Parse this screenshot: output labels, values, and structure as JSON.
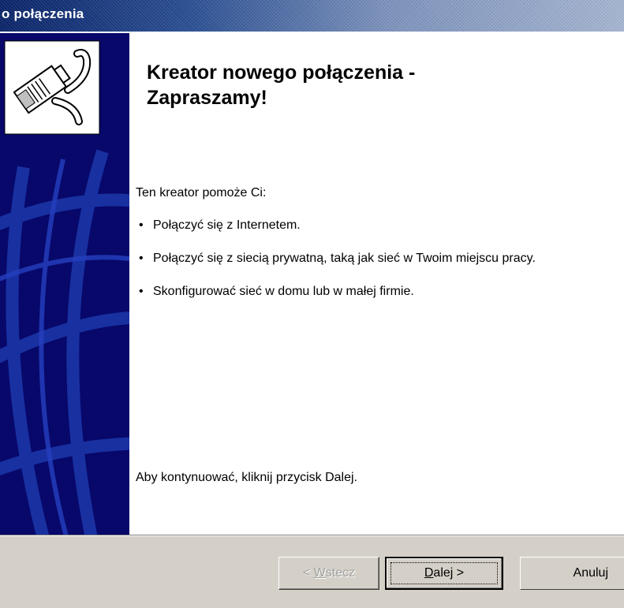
{
  "window": {
    "title": "o połączenia"
  },
  "banner": {
    "icon": "network-cable-plug-icon",
    "background_color": "#07086a"
  },
  "content": {
    "heading_line1": "Kreator nowego połączenia -",
    "heading_line2": "Zapraszamy!",
    "intro": "Ten kreator pomoże Ci:",
    "bullets": [
      "Połączyć się z Internetem.",
      "Połączyć się z siecią prywatną, taką jak sieć w Twoim miejscu pracy.",
      "Skonfigurować sieć w domu lub w małej firmie."
    ],
    "footer": "Aby kontynuować, kliknij przycisk Dalej."
  },
  "buttons": {
    "back": {
      "prefix": "< ",
      "mnemonic": "W",
      "rest": "stecz",
      "enabled": false
    },
    "next": {
      "mnemonic": "D",
      "rest": "alej >",
      "enabled": true,
      "default": true
    },
    "cancel": {
      "label": "Anuluj",
      "enabled": true
    }
  },
  "colors": {
    "title_bar_start": "#0a246a",
    "title_bar_end": "#a6b6d2",
    "dialog_face": "#d4d0c8"
  }
}
